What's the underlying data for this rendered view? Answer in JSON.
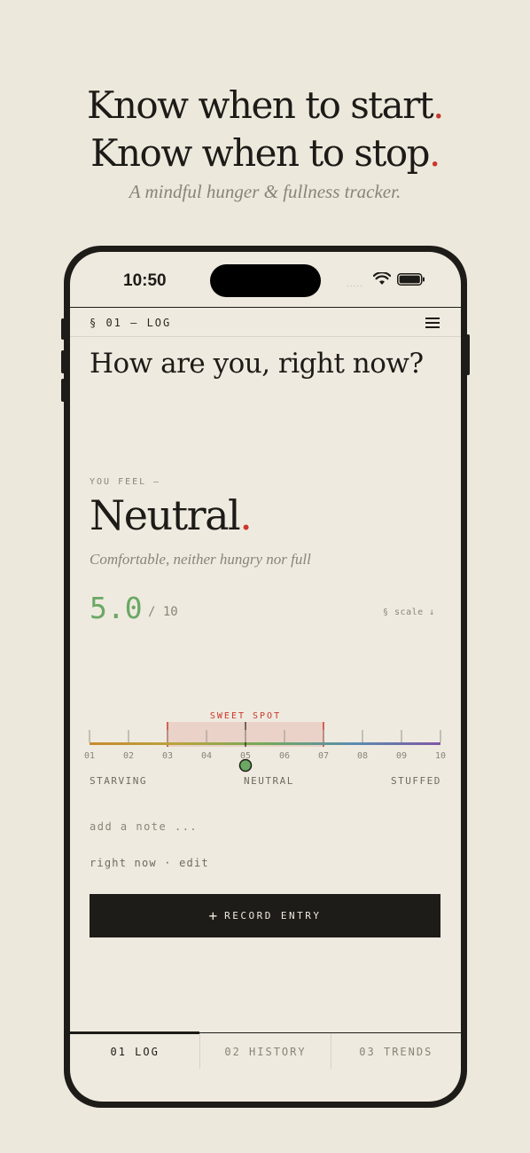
{
  "hero": {
    "line1": "Know when to start",
    "line2": "Know when to stop",
    "dot": ".",
    "tagline": "A mindful hunger & fullness tracker."
  },
  "status": {
    "time": "10:50",
    "signal": "....."
  },
  "header": {
    "section": "§ 01 — LOG"
  },
  "main": {
    "question": "How are you, right now?",
    "feel_label": "YOU FEEL —",
    "state": "Neutral",
    "state_dot": ".",
    "description": "Comfortable, neither hungry nor full",
    "score": "5.0",
    "score_max": "/ 10",
    "scale_link": "§ scale ↓"
  },
  "scale": {
    "min": 1,
    "max": 10,
    "value": 5.0,
    "sweet_spot_label": "SWEET SPOT",
    "sweet_spot_range": [
      3,
      7
    ],
    "tick_labels": [
      "01",
      "02",
      "03",
      "04",
      "05",
      "06",
      "07",
      "08",
      "09",
      "10"
    ],
    "anchors": {
      "low": "STARVING",
      "mid": "NEUTRAL",
      "high": "STUFFED"
    },
    "gradient_colors": [
      "#c8892f",
      "#b9a43c",
      "#72a95b",
      "#5a8db0",
      "#7d57a6"
    ],
    "sweet_spot_color": "#c8382c",
    "thumb_color": "#6aa864"
  },
  "note": {
    "placeholder": "add a note ..."
  },
  "entry_time": "right now · edit",
  "actions": {
    "record_plus": "+",
    "record_label": "RECORD ENTRY"
  },
  "tabs": [
    "01 LOG",
    "02 HISTORY",
    "03 TRENDS"
  ]
}
